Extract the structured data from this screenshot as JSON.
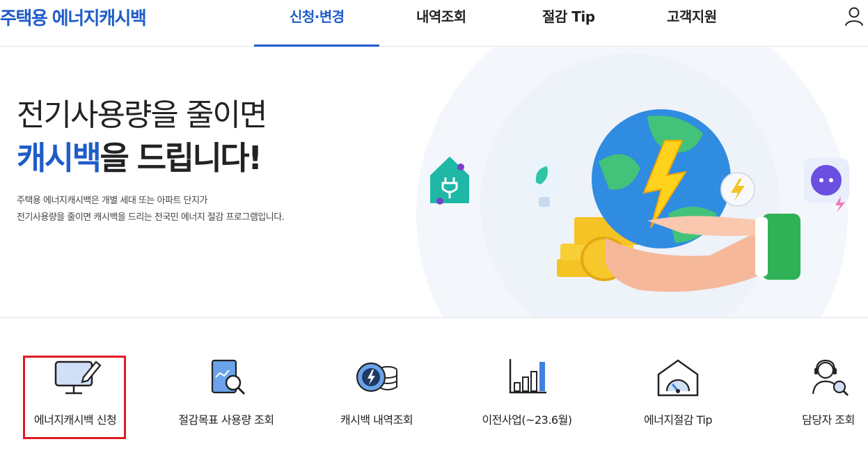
{
  "header": {
    "logo": "주택용 에너지캐시백",
    "nav": [
      {
        "label": "신청·변경",
        "active": true
      },
      {
        "label": "내역조회",
        "active": false
      },
      {
        "label": "절감 Tip",
        "active": false
      },
      {
        "label": "고객지원",
        "active": false
      }
    ]
  },
  "hero": {
    "title_line1": "전기사용량을 줄이면",
    "title_line2_accent": "캐시백",
    "title_line2_rest": "을 드립니다!",
    "desc_line1": "주택용 에너지캐시백은 개별 세대 또는 아파트 단지가",
    "desc_line2": "전기사용량을 줄이면 캐시백을 드리는 전국민 에너지 절감 프로그램입니다."
  },
  "quick_menu": [
    {
      "label": "에너지캐시백 신청",
      "icon": "monitor-pen-icon"
    },
    {
      "label": "절감목표 사용량 조회",
      "icon": "document-search-icon"
    },
    {
      "label": "캐시백 내역조회",
      "icon": "energy-coin-icon"
    },
    {
      "label": "이전사업(~23.6월)",
      "icon": "bar-chart-icon"
    },
    {
      "label": "에너지절감 Tip",
      "icon": "house-gauge-icon"
    },
    {
      "label": "담당자 조회",
      "icon": "support-agent-icon"
    }
  ],
  "colors": {
    "brand": "#1f5cc9",
    "highlight": "#e01b22"
  }
}
